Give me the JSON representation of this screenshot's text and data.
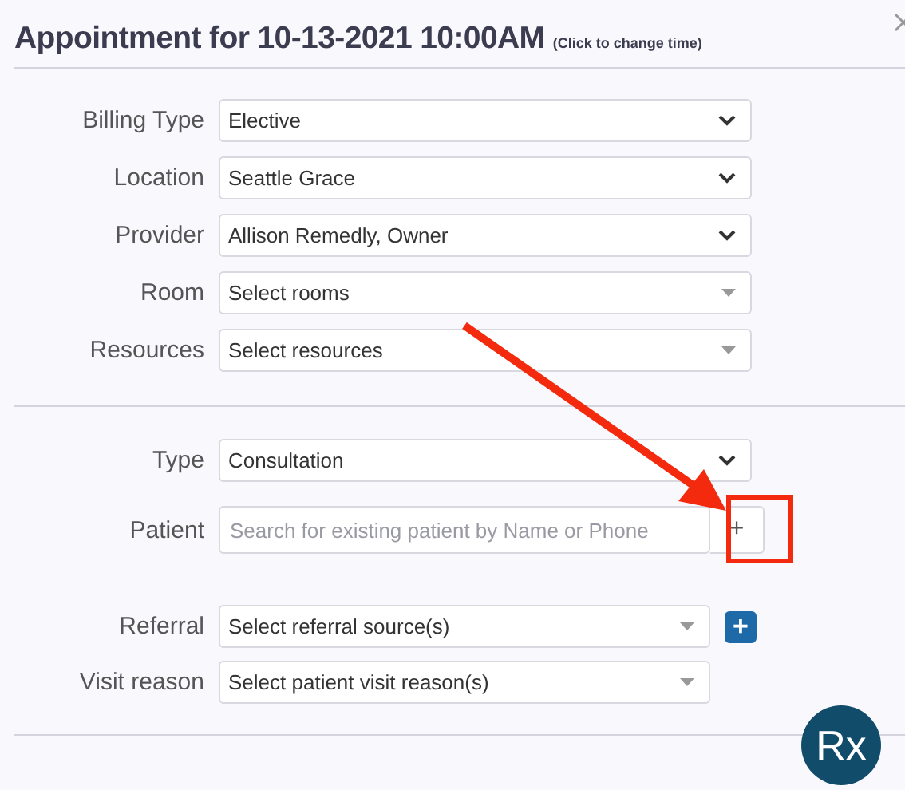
{
  "title": {
    "text": "Appointment for 10-13-2021 10:00AM",
    "hint": "(Click to change time)"
  },
  "section_1": [
    {
      "label": "Billing Type",
      "kind": "select",
      "value": "Elective"
    },
    {
      "label": "Location",
      "kind": "select",
      "value": "Seattle Grace"
    },
    {
      "label": "Provider",
      "kind": "select",
      "value": "Allison Remedly, Owner"
    },
    {
      "label": "Room",
      "kind": "multiselect",
      "value": "Select rooms"
    },
    {
      "label": "Resources",
      "kind": "multiselect",
      "value": "Select resources"
    }
  ],
  "section_2": [
    {
      "label": "Type",
      "kind": "select",
      "value": "Consultation"
    },
    {
      "label": "Patient",
      "kind": "search",
      "placeholder": "Search for existing patient by Name or Phone",
      "add": "+"
    },
    {
      "label": "Referral",
      "kind": "multiselect",
      "value": "Select referral source(s)",
      "add": "+"
    },
    {
      "label": "Visit reason",
      "kind": "multiselect",
      "value": "Select patient visit reason(s)"
    }
  ],
  "badge": "Rx"
}
